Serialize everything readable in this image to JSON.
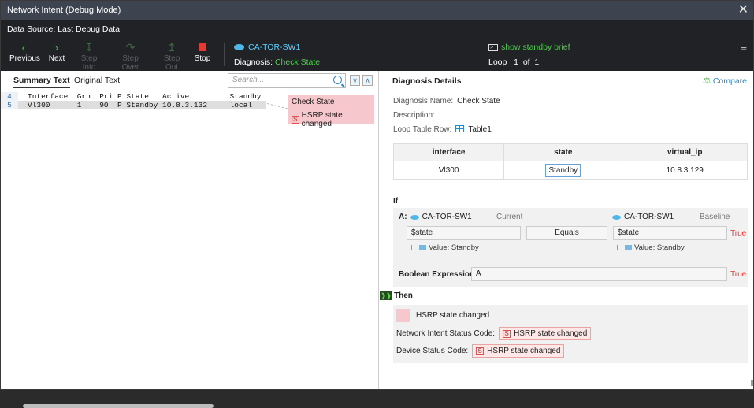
{
  "window": {
    "title": "Network Intent (Debug Mode)",
    "close_glyph": "✕"
  },
  "data_source": {
    "label": "Data Source:",
    "value": "Last Debug Data"
  },
  "toolbar": {
    "previous": "Previous",
    "next": "Next",
    "step_into": "Step Into",
    "step_over": "Step Over",
    "step_out": "Step Out",
    "stop": "Stop",
    "device": "CA-TOR-SW1",
    "diagnosis_label": "Diagnosis:",
    "diagnosis_value": "Check State",
    "command": "show standby brief",
    "loop_label": "Loop",
    "loop_current": "1",
    "loop_of": "of",
    "loop_total": "1",
    "menu_glyph": "≡"
  },
  "left": {
    "tabs": [
      {
        "label": "Summary Text",
        "active": true
      },
      {
        "label": "Original Text",
        "active": false
      }
    ],
    "search": {
      "placeholder": "Search..."
    },
    "lines": [
      {
        "num": "4",
        "text": "Interface  Grp  Pri P State   Active         Standby"
      },
      {
        "num": "5",
        "text": "Vl300      1    90  P Standby 10.8.3.132     local"
      }
    ],
    "note": {
      "title": "Check State",
      "status": "HSRP state changed",
      "badge": "S"
    }
  },
  "right": {
    "title": "Diagnosis Details",
    "compare": "Compare",
    "diagnosis_name_label": "Diagnosis Name:",
    "diagnosis_name": "Check State",
    "description_label": "Description:",
    "loop_table_label": "Loop Table Row:",
    "loop_table": "Table1",
    "table": {
      "headers": [
        "interface",
        "state",
        "virtual_ip"
      ],
      "row": [
        "Vl300",
        "Standby",
        "10.8.3.129"
      ]
    },
    "if": {
      "label": "If",
      "a_label": "A:",
      "left_device": "CA-TOR-SW1",
      "left_mode": "Current",
      "right_device": "CA-TOR-SW1",
      "right_mode": "Baseline",
      "left_var": "$state",
      "operator": "Equals",
      "right_var": "$state",
      "result": "True",
      "left_value": "Value: Standby",
      "right_value": "Value: Standby",
      "bool_label": "Boolean Expression:",
      "bool_value": "A",
      "bool_result": "True"
    },
    "then": {
      "label": "Then",
      "note_text": "HSRP state changed",
      "ni_label": "Network Intent Status Code:",
      "ni_value": "HSRP state changed",
      "dev_label": "Device Status Code:",
      "dev_value": "HSRP state changed",
      "badge": "S"
    }
  },
  "colors": {
    "accent_green": "#42c04b",
    "link_blue": "#2a87c8",
    "note_pink": "#f6c7cc",
    "true_red": "#e53935"
  }
}
